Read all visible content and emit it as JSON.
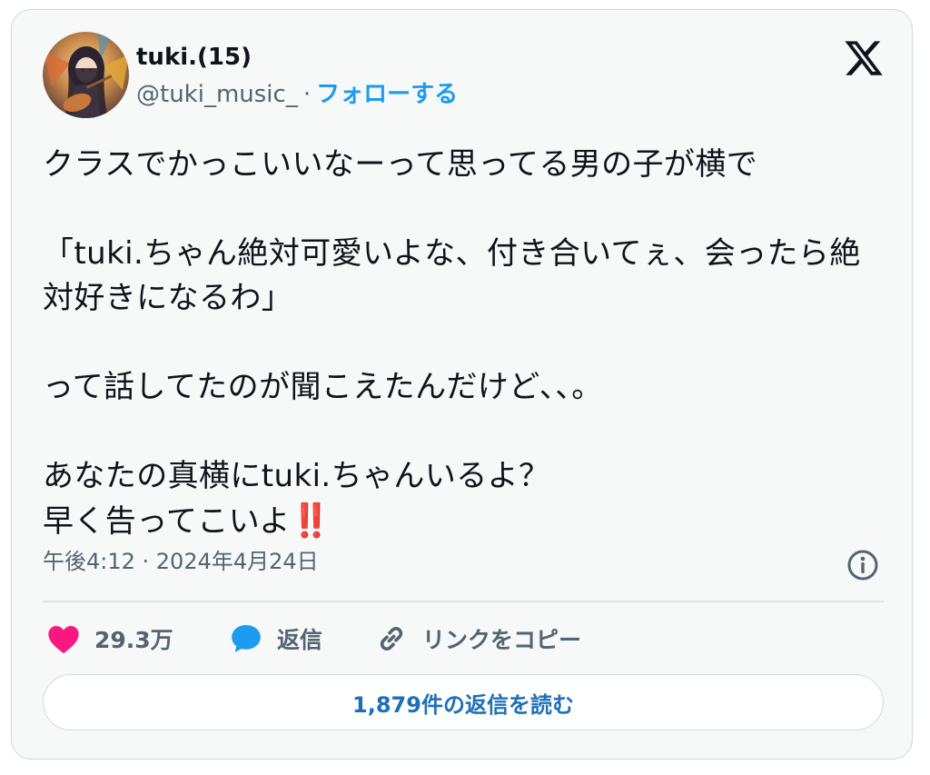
{
  "author": {
    "display_name": "tuki.(15)",
    "handle": "@tuki_music_",
    "separator": "·",
    "follow_label": "フォローする"
  },
  "tweet": {
    "paragraphs": [
      "クラスでかっこいいなーって思ってる男の子が横で",
      "「tuki.ちゃん絶対可愛いよな、付き合いてぇ、会ったら絶対好きになるわ」",
      "って話してたのが聞こえたんだけど､､｡",
      "あなたの真横にtuki.ちゃんいるよ？\n早く告ってこいよ"
    ],
    "emoji": "‼️",
    "timestamp": "午後4:12 · 2024年4月24日"
  },
  "actions": {
    "like_count": "29.3万",
    "reply_label": "返信",
    "copy_link_label": "リンクをコピー"
  },
  "read_replies_label": "1,879件の返信を読む",
  "icons": {
    "logo": "x-logo-icon",
    "info": "info-icon",
    "like": "heart-icon",
    "reply": "speech-bubble-icon",
    "copy": "link-icon"
  },
  "colors": {
    "accent": "#1d9bf0",
    "heart": "#f91880",
    "reply_bubble": "#1d9bf0",
    "emoji_red": "#c8102e",
    "muted_text": "#536471"
  }
}
